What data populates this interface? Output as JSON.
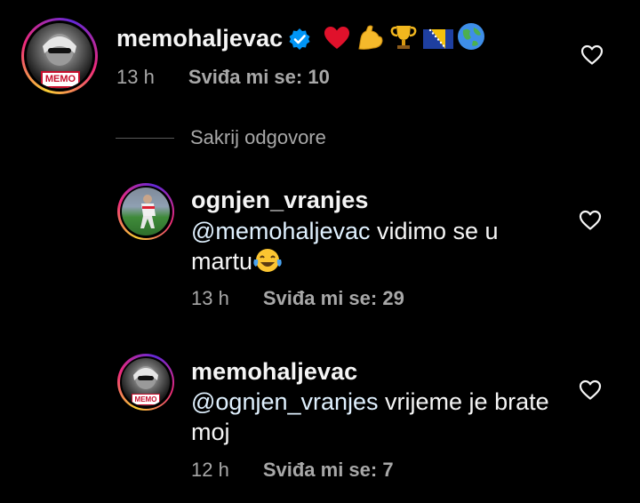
{
  "comments": [
    {
      "username": "memohaljevac",
      "verified": true,
      "emojis": [
        "heart-icon",
        "flexed-biceps-icon",
        "trophy-icon",
        "bosnia-flag-icon",
        "globe-icon"
      ],
      "time": "13 h",
      "likes": "Sviđa mi se: 10"
    }
  ],
  "replies_toggle": "Sakrij odgovore",
  "replies": [
    {
      "username": "ognjen_vranjes",
      "mention": "@memohaljevac",
      "text_line1": " vidimo se u",
      "text_line2": "martu",
      "time": "13 h",
      "likes": "Sviđa mi se: 29"
    },
    {
      "username": "memohaljevac",
      "mention": "@ognjen_vranjes",
      "text_line1": " vrijeme je brate",
      "text_line2": "moj",
      "time": "12 h",
      "likes": "Sviđa mi se: 7"
    }
  ],
  "colors": {
    "background": "#000000",
    "text": "#f5f5f5",
    "secondary": "#a8a8a8",
    "verified_badge": "#0095f6"
  },
  "avatar_badges": [
    "MEMO",
    "MEMO"
  ]
}
